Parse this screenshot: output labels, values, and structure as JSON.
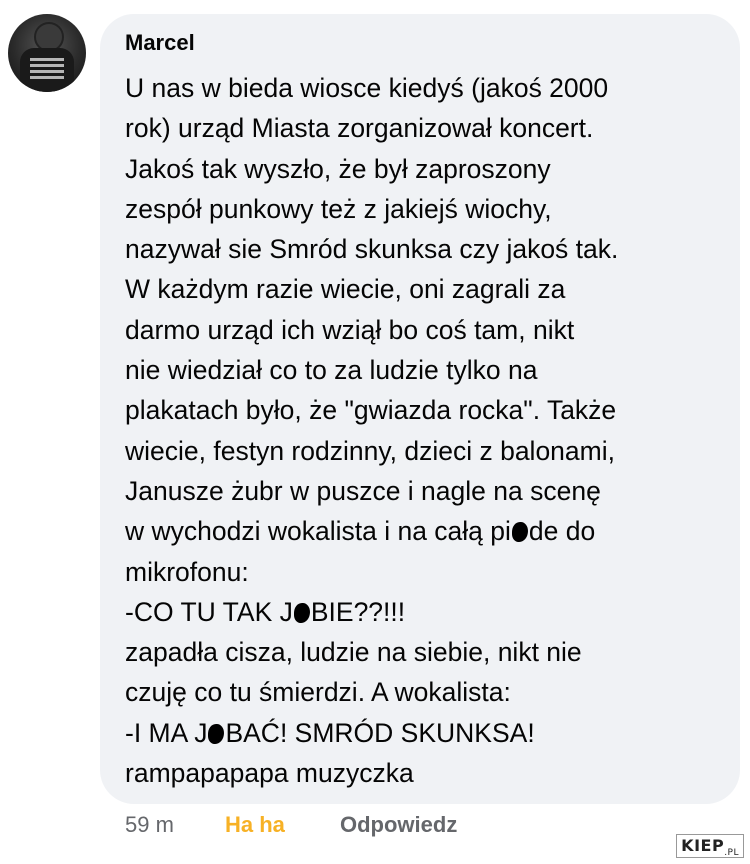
{
  "comment": {
    "author": "Marcel",
    "lines": [
      "U nas w bieda wiosce kiedyś (jakoś 2000",
      "rok) urząd Miasta zorganizował koncert.",
      "Jakoś tak wyszło, że był zaproszony",
      "zespół punkowy też z jakiejś wiochy,",
      "nazywał sie Smród skunksa czy jakoś tak.",
      "W każdym razie wiecie, oni zagrali za",
      "darmo urząd ich wziął bo coś tam, nikt",
      "nie wiedział co to za ludzie tylko na",
      "plakatach było, że \"gwiazda rocka\". Także",
      "wiecie, festyn rodzinny, dzieci z balonami,",
      "Janusze żubr w puszce i nagle na scenę",
      [
        "w wychodzi wokalista i na całą pi",
        "de do"
      ],
      "mikrofonu:",
      [
        "-CO TU TAK J",
        "BIE??!!!"
      ],
      "zapadła cisza, ludzie na siebie, nikt nie",
      "czuję co tu śmierdzi. A wokalista:",
      [
        "-I MA J",
        "BAĆ! SMRÓD SKUNKSA!"
      ],
      "rampapapapa muzyczka"
    ]
  },
  "actions": {
    "time": "59 m",
    "reaction": "Ha ha",
    "reply": "Odpowiedz"
  },
  "watermark": {
    "main": "KIEP",
    "suffix": ".PL"
  },
  "colors": {
    "bubble": "#f0f2f5",
    "text": "#050505",
    "muted": "#65676b",
    "haha": "#f7b125"
  }
}
